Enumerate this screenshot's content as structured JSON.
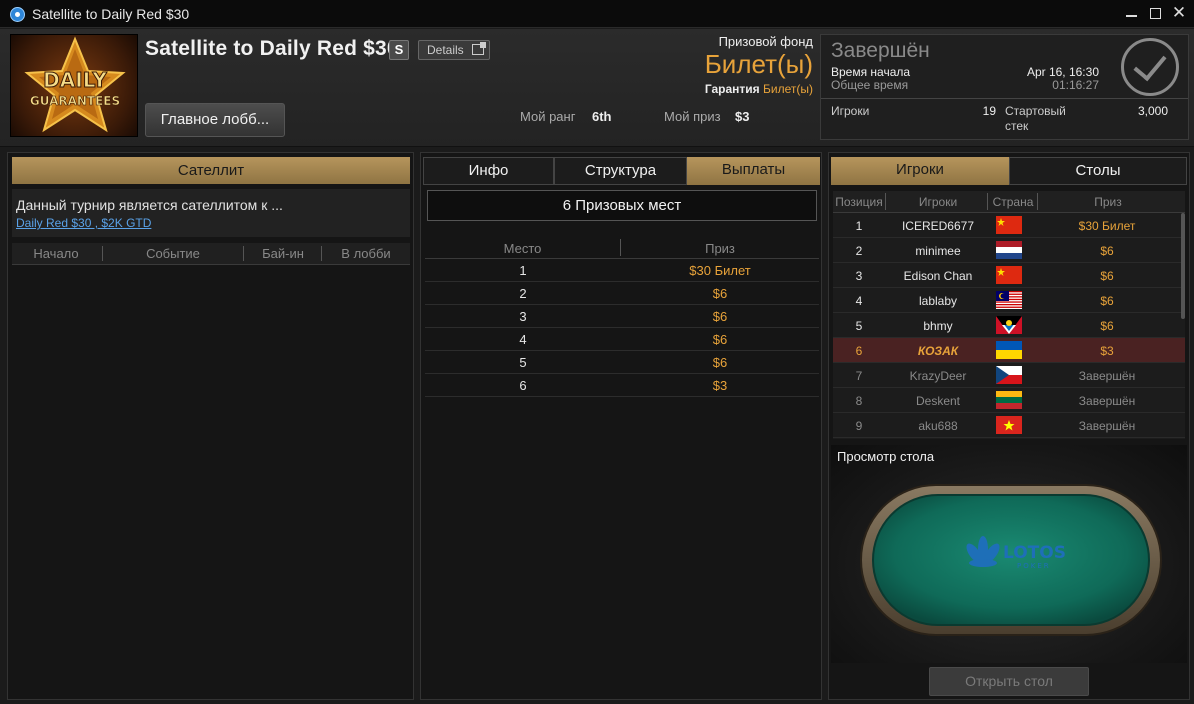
{
  "window": {
    "title": "Satellite to Daily Red $30"
  },
  "header": {
    "tournament_name": "Satellite to Daily Red $30",
    "speed_badge": "S",
    "details_label": "Details",
    "lobby_button": "Главное лобб...",
    "my_rank_label": "Мой ранг",
    "my_rank_value": "6th",
    "my_prize_label": "Мой приз",
    "my_prize_value": "$3",
    "prize_pool_label": "Призовой фонд",
    "prize_pool_value": "Билет(ы)",
    "guarantee_label": "Гарантия",
    "guarantee_value": "Билет(ы)",
    "logo_text_1": "DAILY",
    "logo_text_2": "GUARANTEES"
  },
  "status": {
    "state": "Завершён",
    "start_time_label": "Время начала",
    "start_time_value": "Apr 16, 16:30",
    "total_time_label": "Общее время",
    "total_time_value": "01:16:27",
    "players_label": "Игроки",
    "players_value": "19",
    "starting_stack_label": "Стартовый стек",
    "starting_stack_value": "3,000"
  },
  "left_panel": {
    "header": "Сателлит",
    "description": "Данный турнир является сателлитом к ...",
    "link": "Daily Red $30 , $2K GTD",
    "columns": [
      "Начало",
      "Событие",
      "Бай-ин",
      "В лобби"
    ]
  },
  "mid_panel": {
    "tabs": [
      "Инфо",
      "Структура",
      "Выплаты"
    ],
    "active_tab": "Выплаты",
    "places_title": "6 Призовых мест",
    "col_place": "Место",
    "col_prize": "Приз",
    "payouts": [
      {
        "place": "1",
        "prize": "$30 Билет"
      },
      {
        "place": "2",
        "prize": "$6"
      },
      {
        "place": "3",
        "prize": "$6"
      },
      {
        "place": "4",
        "prize": "$6"
      },
      {
        "place": "5",
        "prize": "$6"
      },
      {
        "place": "6",
        "prize": "$3"
      }
    ]
  },
  "right_panel": {
    "tabs": [
      "Игроки",
      "Столы"
    ],
    "active_tab": "Игроки",
    "columns": [
      "Позиция",
      "Игроки",
      "Страна",
      "Приз"
    ],
    "players": [
      {
        "pos": "1",
        "name": "ICERED6677",
        "flag": "cn",
        "prize": "$30 Билет",
        "state": "active"
      },
      {
        "pos": "2",
        "name": "minimee",
        "flag": "nl",
        "prize": "$6",
        "state": "active"
      },
      {
        "pos": "3",
        "name": "Edison Chan",
        "flag": "cn",
        "prize": "$6",
        "state": "active"
      },
      {
        "pos": "4",
        "name": "lablaby",
        "flag": "my",
        "prize": "$6",
        "state": "active"
      },
      {
        "pos": "5",
        "name": "bhmy",
        "flag": "ag",
        "prize": "$6",
        "state": "active"
      },
      {
        "pos": "6",
        "name": "КОЗАК",
        "flag": "ua",
        "prize": "$3",
        "state": "me"
      },
      {
        "pos": "7",
        "name": "KrazyDeer",
        "flag": "cz",
        "prize": "Завершён",
        "state": "done"
      },
      {
        "pos": "8",
        "name": "Deskent",
        "flag": "lt",
        "prize": "Завершён",
        "state": "done"
      },
      {
        "pos": "9",
        "name": "aku688",
        "flag": "vn",
        "prize": "Завершён",
        "state": "done"
      }
    ],
    "table_view_label": "Просмотр стола",
    "table_brand": "LOTOS",
    "table_brand_sub": "POKER",
    "open_table_button": "Открыть стол"
  },
  "colors": {
    "gold": "#b6955c",
    "accent_orange": "#e8a33a",
    "link_blue": "#5aa2e8",
    "felt_green": "#0f6a58"
  }
}
